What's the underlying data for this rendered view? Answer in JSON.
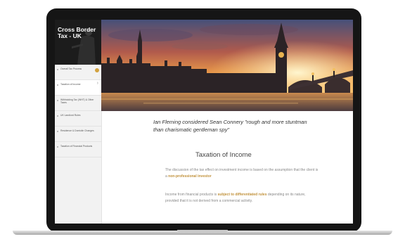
{
  "brand": {
    "line1": "Cross Border",
    "line2": "Tax - UK"
  },
  "menu": [
    {
      "label": "Overall Tax Process",
      "badge": true
    },
    {
      "label": "Taxation of Income",
      "active": true
    },
    {
      "label": "Withholding Tax (WHT) & Other Taxes"
    },
    {
      "label": "UK Landlord Rules"
    },
    {
      "label": "Residence & Domicile Changes"
    },
    {
      "label": "Taxation of Financial Products"
    }
  ],
  "quote": "Ian Fleming considered Sean Connery \"rough and more stuntman than charismatic gentleman spy\"",
  "heading": "Taxation of Income",
  "para1": {
    "text": "The discussion of the tax effect on investment income is based on the assumption that the client is a",
    "highlight": "non-professional investor"
  },
  "para2": {
    "lead": "Income from financial products is",
    "highlight": "subject to differentiated rules",
    "rest": "depending on its nature, provided that it is not derived from a commercial activity."
  },
  "colors": {
    "accent": "#c1913a",
    "badge": "#d2a23f"
  }
}
